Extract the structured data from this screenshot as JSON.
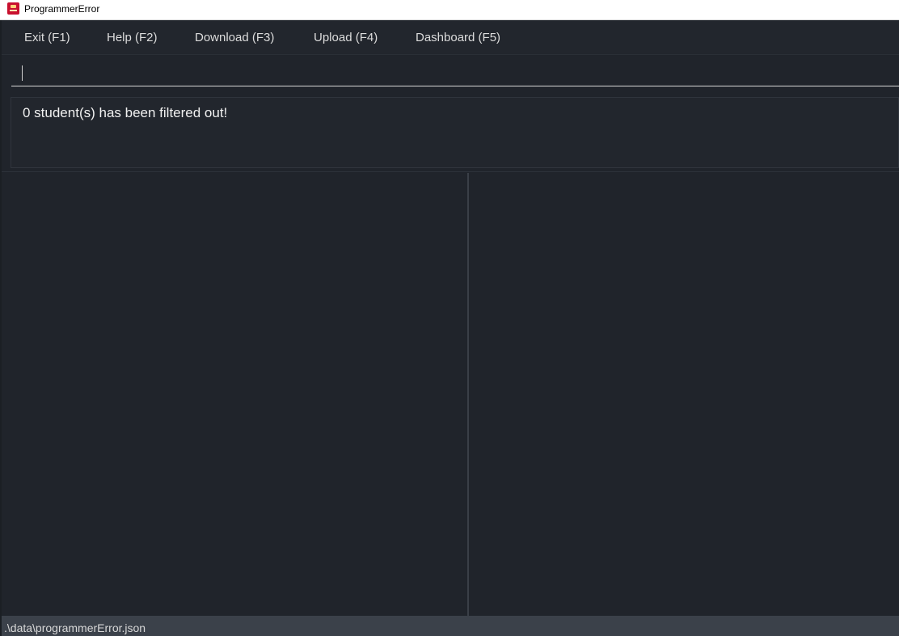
{
  "window": {
    "title": "ProgrammerError",
    "icon": "programmererror-app-icon"
  },
  "menu": {
    "items": [
      {
        "label": "Exit (F1)"
      },
      {
        "label": "Help (F2)"
      },
      {
        "label": "Download (F3)"
      },
      {
        "label": "Upload (F4)"
      },
      {
        "label": "Dashboard (F5)"
      }
    ]
  },
  "command": {
    "value": ""
  },
  "result": {
    "message": "0 student(s) has been filtered out!"
  },
  "status": {
    "file_path": ".\\data\\programmerError.json"
  },
  "colors": {
    "app_background": "#20242b",
    "status_background": "#3b414a",
    "menu_text": "#dcdcdc"
  }
}
